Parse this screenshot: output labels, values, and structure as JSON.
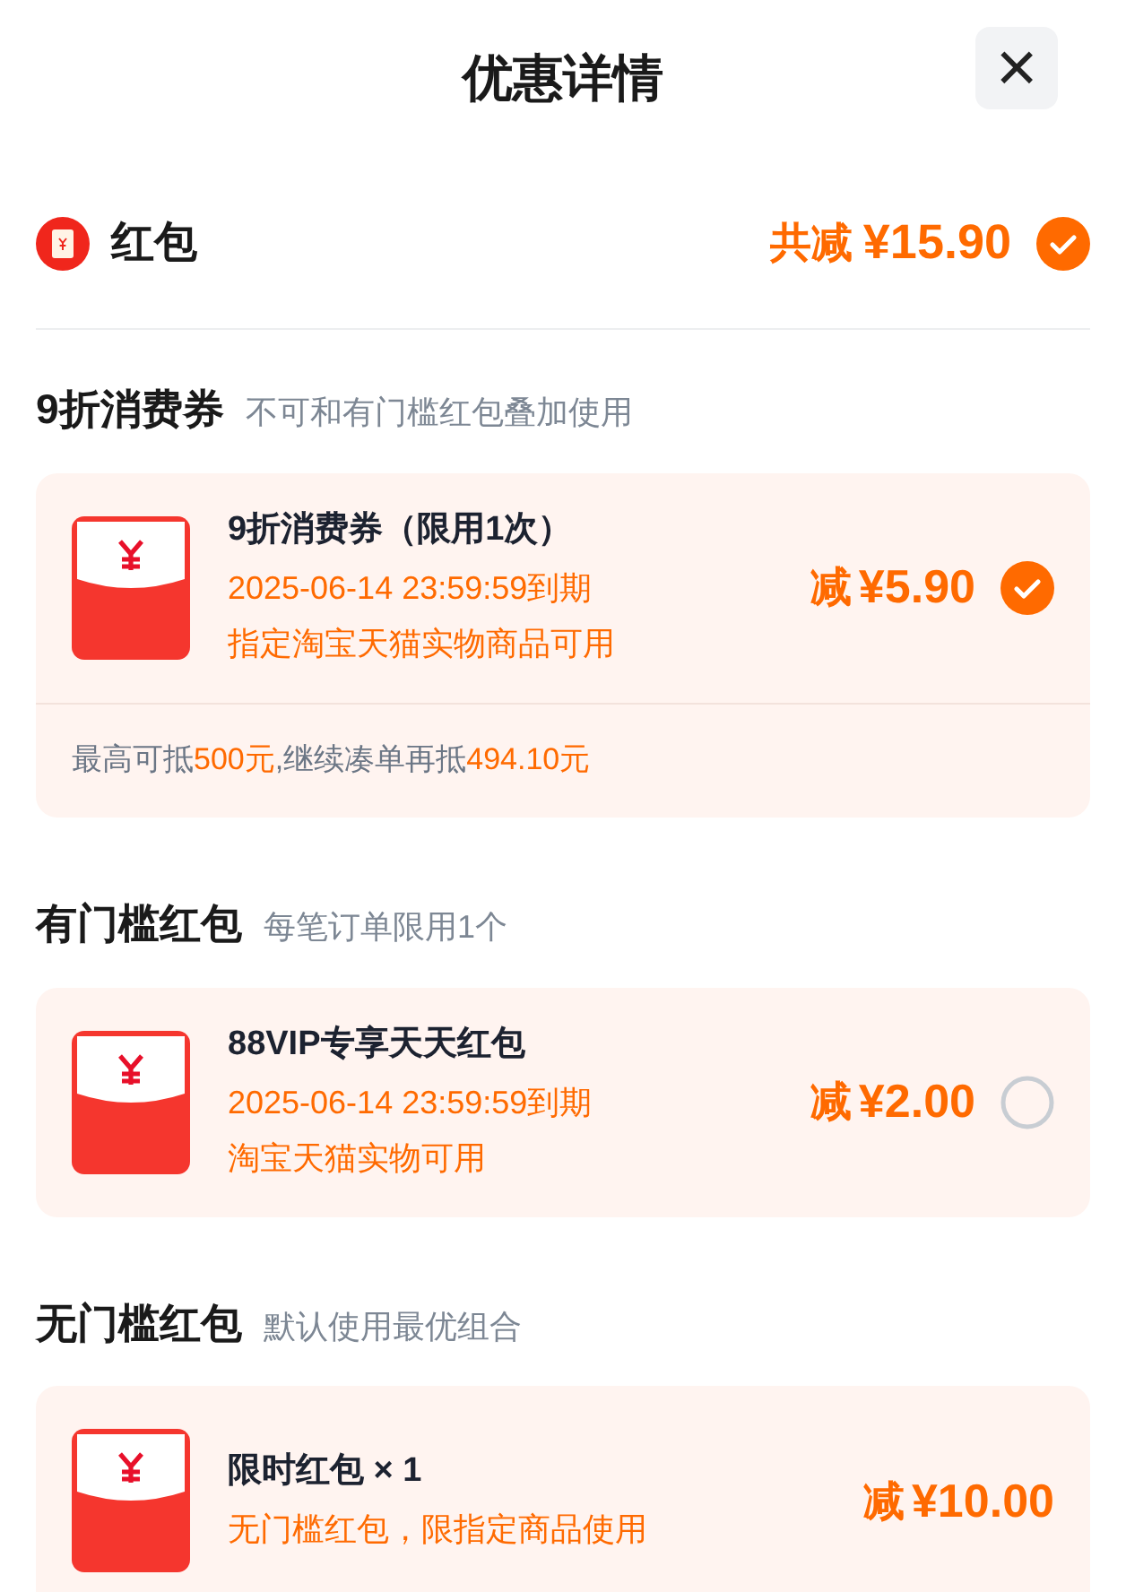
{
  "header": {
    "title": "优惠详情",
    "close": "×"
  },
  "summary": {
    "label": "红包",
    "total_prefix": "共减",
    "total": "¥15.90",
    "selected": true
  },
  "sections": [
    {
      "title": "9折消费券",
      "note": "不可和有门槛红包叠加使用",
      "cards": [
        {
          "title": "9折消费券（限用1次）",
          "lines": [
            "2025-06-14 23:59:59到期",
            "指定淘宝天猫实物商品可用"
          ],
          "prefix": "减",
          "amount": "¥5.90",
          "kind": "selectable",
          "selected": true,
          "footer": [
            {
              "text": "最高可抵",
              "highlight": false
            },
            {
              "text": "500元",
              "highlight": true
            },
            {
              "text": ",继续凑单再抵",
              "highlight": false
            },
            {
              "text": "494.10元",
              "highlight": true
            }
          ]
        }
      ]
    },
    {
      "title": "有门槛红包",
      "note": "每笔订单限用1个",
      "cards": [
        {
          "title": "88VIP专享天天红包",
          "lines": [
            "2025-06-14 23:59:59到期",
            "淘宝天猫实物可用"
          ],
          "prefix": "减",
          "amount": "¥2.00",
          "kind": "selectable",
          "selected": false
        }
      ]
    },
    {
      "title": "无门槛红包",
      "note": "默认使用最优组合",
      "cards": [
        {
          "title": "限时红包 × 1",
          "lines": [
            "无门槛红包，限指定商品使用"
          ],
          "prefix": "减",
          "amount": "¥10.00",
          "kind": "fixed"
        }
      ]
    }
  ]
}
